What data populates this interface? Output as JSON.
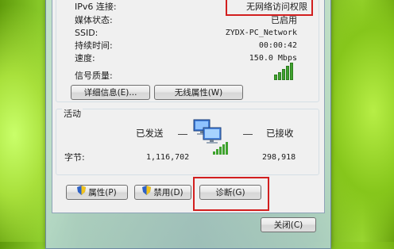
{
  "connection": {
    "ipv6_label": "IPv6 连接:",
    "ipv6_value": "无网络访问权限",
    "media_label": "媒体状态:",
    "media_value": "已启用",
    "ssid_label": "SSID:",
    "ssid_value": "ZYDX-PC_Network",
    "duration_label": "持续时间:",
    "duration_value": "00:00:42",
    "speed_label": "速度:",
    "speed_value": "150.0 Mbps",
    "signal_label": "信号质量:",
    "signal_bars": 5,
    "signal_active": 5
  },
  "buttons": {
    "details": "详细信息(E)...",
    "wireless_props": "无线属性(W)",
    "properties": "属性(P)",
    "disable": "禁用(D)",
    "diagnose": "诊断(G)",
    "close": "关闭(C)"
  },
  "activity": {
    "title": "活动",
    "sent_label": "已发送",
    "received_label": "已接收",
    "bytes_label": "字节:",
    "sent_bytes": "1,116,702",
    "received_bytes": "298,918"
  },
  "colors": {
    "highlight": "#d21f1f",
    "signal_green": "#3fa32e"
  }
}
